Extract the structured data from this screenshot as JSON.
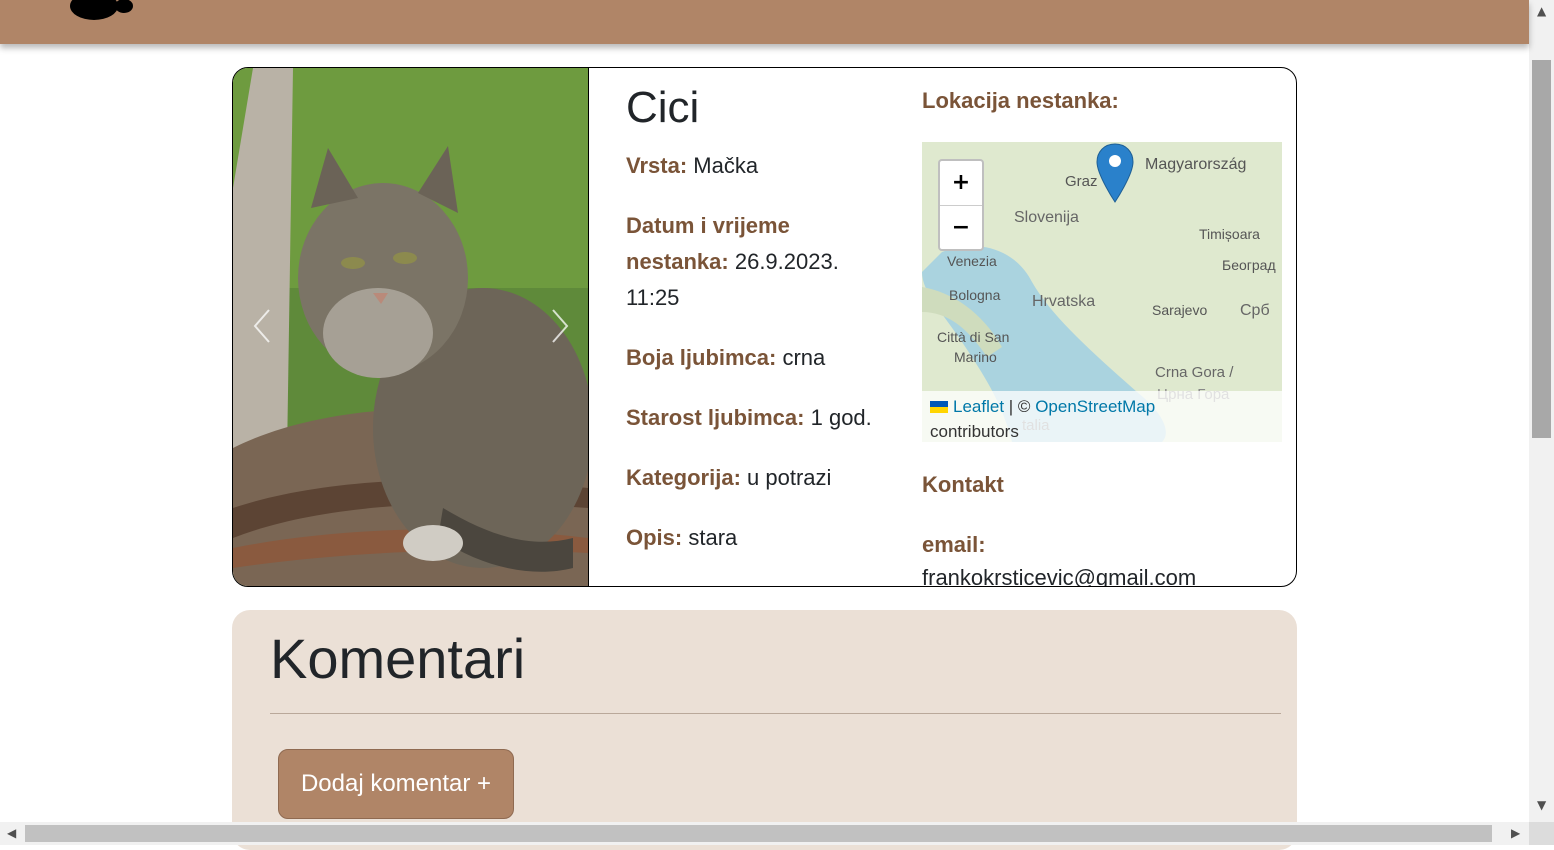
{
  "pet": {
    "name": "Cici",
    "species_label": "Vrsta:",
    "species": "Mačka",
    "datetime_label": "Datum i vrijeme nestanka:",
    "datetime": "26.9.2023. 11:25",
    "color_label": "Boja ljubimca:",
    "color": "crna",
    "age_label": "Starost ljubimca:",
    "age": "1 god.",
    "category_label": "Kategorija:",
    "category": "u potrazi",
    "desc_label": "Opis:",
    "desc": "stara"
  },
  "location": {
    "heading": "Lokacija nestanka:",
    "map_labels": [
      "Magyarország",
      "Graz",
      "Slovenija",
      "Timișoara",
      "Venezia",
      "Београд",
      "Bologna",
      "Hrvatska",
      "Sarajevo",
      "Срб",
      "Città di San",
      "Marino",
      "Crna Gora /",
      "Црна Гора",
      "talia"
    ],
    "zoom_in": "+",
    "zoom_out": "−",
    "attr_leaflet": "Leaflet",
    "attr_sep": "| ©",
    "attr_osm": "OpenStreetMap",
    "attr_contrib": "contributors"
  },
  "contact": {
    "heading": "Kontakt",
    "email_label": "email:",
    "email": "frankokrsticevic@gmail.com"
  },
  "comments": {
    "title": "Komentari",
    "add_button": "Dodaj komentar +"
  },
  "colors": {
    "brand": "#b08567",
    "label": "#7a5438",
    "comments_bg": "#ebe0d6"
  }
}
